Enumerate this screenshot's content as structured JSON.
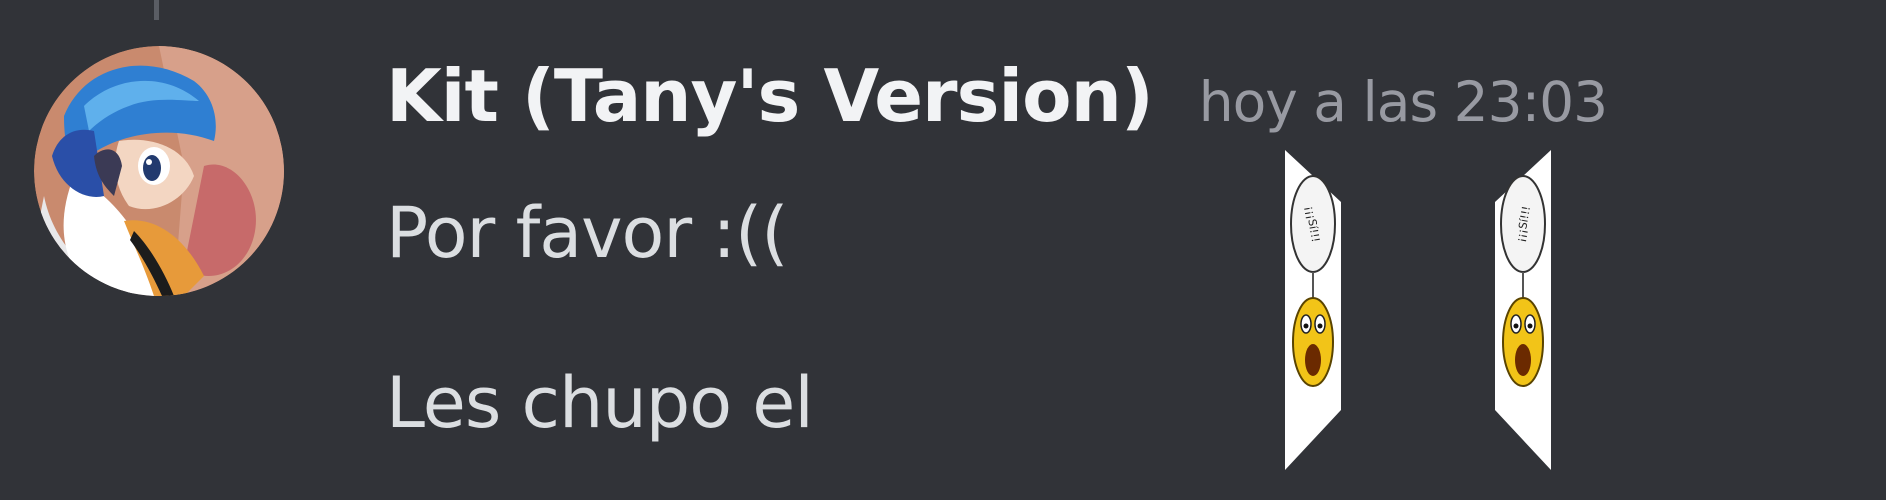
{
  "message": {
    "author": "Kit (Tany's Version)",
    "timestamp": "hoy a las 23:03",
    "lines": [
      "Por favor :((",
      "Les chupo el"
    ],
    "stickers": [
      {
        "icon": "shouting-smiley-sign-icon",
        "text": "¡¡¡Sí!!!"
      },
      {
        "icon": "shouting-smiley-sign-icon",
        "text": "¡¡¡Sí!!!"
      }
    ]
  },
  "avatar": {
    "icon": "anime-character-avatar-icon"
  },
  "colors": {
    "background": "#313338",
    "username": "#f2f3f5",
    "timestamp": "#989aa2",
    "message_text": "#dbdee1"
  }
}
